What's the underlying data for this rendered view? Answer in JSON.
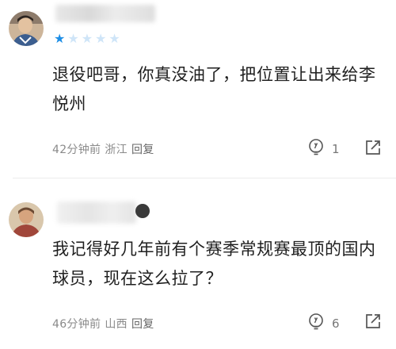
{
  "comments": [
    {
      "rating": {
        "filled": 1,
        "total": 5
      },
      "text": "退役吧哥，你真没油了，把位置让出来给李悦州",
      "time": "42分钟前",
      "location": "浙江",
      "reply_label": "回复",
      "likes": "1",
      "icons": {
        "like": "lightbulb-icon",
        "share": "share-icon"
      }
    },
    {
      "text": "我记得好几年前有个赛季常规赛最顶的国内球员，现在这么拉了？",
      "time": "46分钟前",
      "location": "山西",
      "reply_label": "回复",
      "likes": "6",
      "icons": {
        "like": "lightbulb-icon",
        "share": "share-icon"
      }
    }
  ],
  "colors": {
    "star_active": "#1e8ee6",
    "star_inactive": "#cfe5f8",
    "meta_text": "#8a8a8a"
  }
}
